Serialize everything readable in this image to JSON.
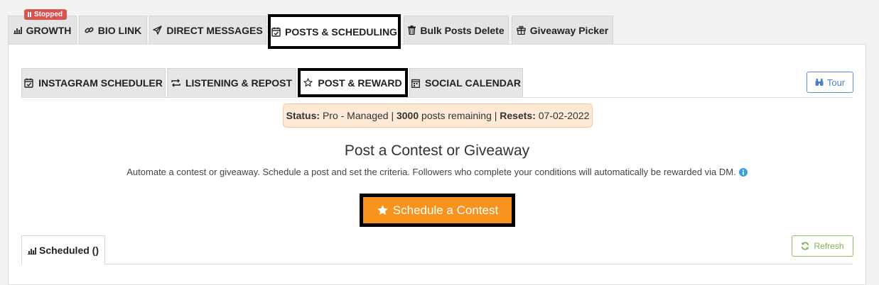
{
  "top_tabs": {
    "growth": {
      "label": "GROWTH",
      "badge": "Stopped"
    },
    "bio_link": {
      "label": "BIO LINK"
    },
    "direct_messages": {
      "label": "DIRECT MESSAGES"
    },
    "posts_scheduling": {
      "label": "POSTS & SCHEDULING"
    },
    "bulk_delete": {
      "label": "Bulk Posts Delete"
    },
    "giveaway_picker": {
      "label": "Giveaway Picker"
    }
  },
  "sub_tabs": {
    "instagram_scheduler": {
      "label": "INSTAGRAM SCHEDULER"
    },
    "listening_repost": {
      "label": "LISTENING & REPOST"
    },
    "post_reward": {
      "label": "POST & REWARD"
    },
    "social_calendar": {
      "label": "SOCIAL CALENDAR"
    }
  },
  "tour_label": "Tour",
  "status": {
    "status_label": "Status:",
    "status_value": " Pro - Managed | ",
    "posts_count": "3000",
    "posts_text": " posts remaining | ",
    "resets_label": "Resets:",
    "resets_value": " 07-02-2022"
  },
  "heading": "Post a Contest or Giveaway",
  "description": "Automate a contest or giveaway. Schedule a post and set the criteria. Followers who complete your conditions will automatically be rewarded via DM.",
  "schedule_button": "Schedule a Contest",
  "scheduled_tab": "Scheduled ()",
  "refresh_label": "Refresh",
  "colors": {
    "accent_orange": "#f7931e",
    "badge_red": "#d9534f",
    "tour_blue": "#4a80cf",
    "refresh_green": "#7ab34c",
    "status_bg": "#fde9d4"
  }
}
